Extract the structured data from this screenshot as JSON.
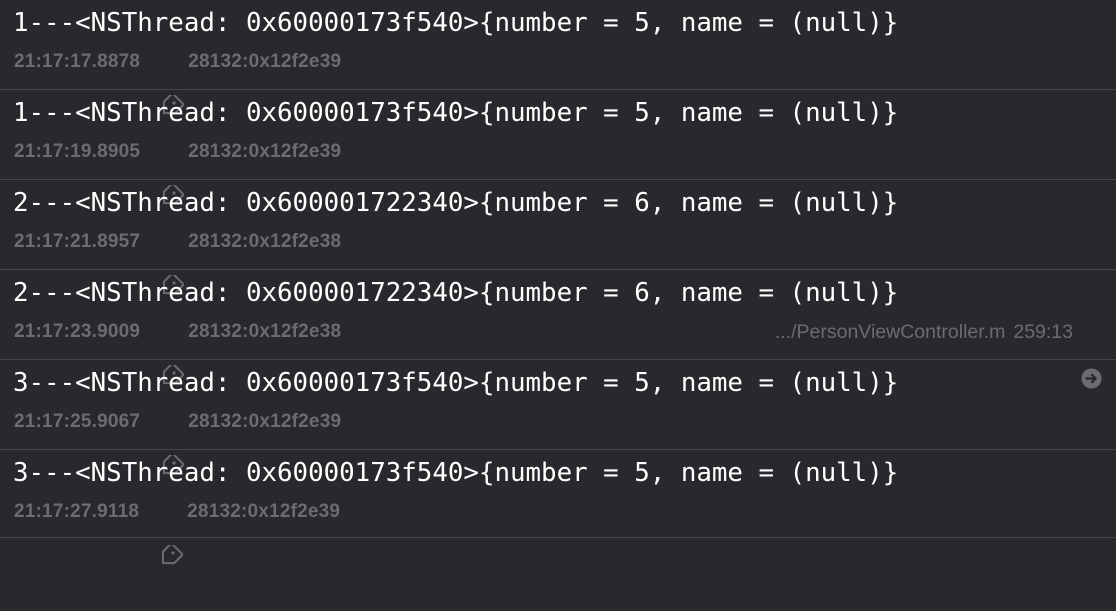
{
  "console": {
    "entries": [
      {
        "message": "1---<NSThread: 0x60000173f540>{number = 5, name = (null)}",
        "time": "21:17:17.8878",
        "thread": "28132:0x12f2e39"
      },
      {
        "message": "1---<NSThread: 0x60000173f540>{number = 5, name = (null)}",
        "time": "21:17:19.8905",
        "thread": "28132:0x12f2e39"
      },
      {
        "message": "2---<NSThread: 0x600001722340>{number = 6, name = (null)}",
        "time": "21:17:21.8957",
        "thread": "28132:0x12f2e38"
      },
      {
        "message": "2---<NSThread: 0x600001722340>{number = 6, name = (null)}",
        "time": "21:17:23.9009",
        "thread": "28132:0x12f2e38",
        "location": {
          "file": ".../PersonViewController.m",
          "line": "259:13"
        }
      },
      {
        "message": "3---<NSThread: 0x60000173f540>{number = 5, name = (null)}",
        "time": "21:17:25.9067",
        "thread": "28132:0x12f2e39"
      },
      {
        "message": "3---<NSThread: 0x60000173f540>{number = 5, name = (null)}",
        "time": "21:17:27.9118",
        "thread": "28132:0x12f2e39"
      }
    ]
  },
  "icons": {
    "tag": "tag-icon",
    "jump": "arrow-circle-right-icon"
  },
  "colors": {
    "background": "#29292d",
    "message_text": "#ffffff",
    "meta_text": "#6c6c70",
    "divider": "#46464b"
  }
}
